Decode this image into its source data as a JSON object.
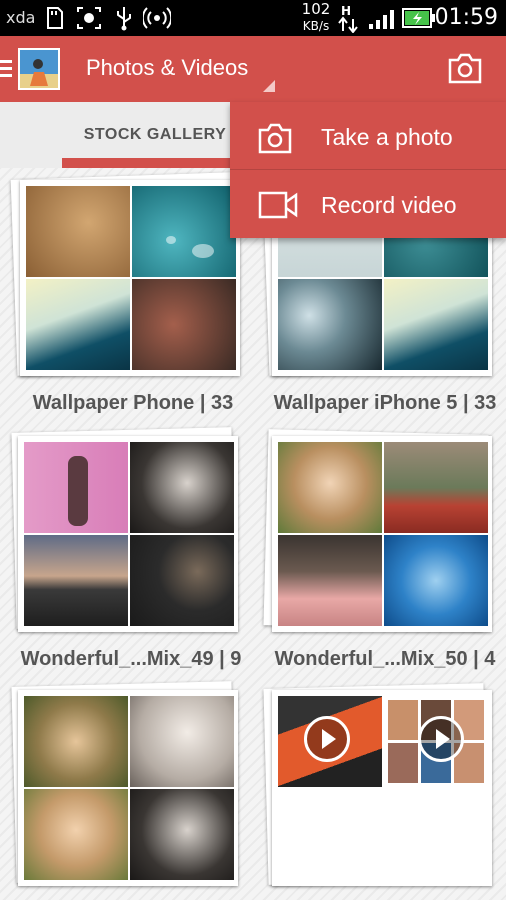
{
  "status_bar": {
    "carrier": "xda",
    "speed_value": "102",
    "speed_unit": "KB/s",
    "time": "01:59"
  },
  "app_bar": {
    "title": "Photos & Videos"
  },
  "tabs": {
    "active_label": "STOCK GALLERY"
  },
  "dropdown": {
    "items": [
      {
        "label": "Take a photo",
        "icon": "camera-icon"
      },
      {
        "label": "Record video",
        "icon": "video-camera-icon"
      }
    ]
  },
  "albums": [
    {
      "label": "Wallpaper Phone | 33"
    },
    {
      "label": "Wallpaper iPhone 5 | 33"
    },
    {
      "label": "Wonderful_...Mix_49 | 9"
    },
    {
      "label": "Wonderful_...Mix_50 | 4"
    },
    {
      "label": ""
    },
    {
      "label": ""
    }
  ],
  "colors": {
    "accent": "#d2504b",
    "status_bar": "#000000",
    "tab_bg": "#ececec"
  }
}
